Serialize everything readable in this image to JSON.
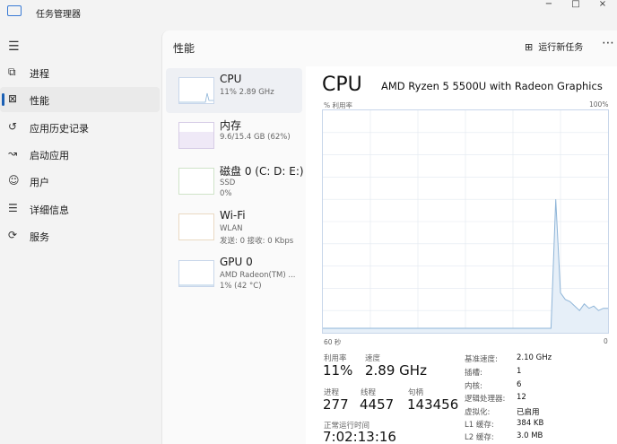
{
  "window": {
    "title": "任务管理器",
    "controls": {
      "minimize": "−",
      "maximize": "□",
      "close": "×"
    }
  },
  "sidebar": {
    "menu_icon": "hamburger-icon",
    "items": [
      {
        "label": "进程",
        "icon": "processes-icon",
        "glyph": "⧉",
        "active": false
      },
      {
        "label": "性能",
        "icon": "performance-icon",
        "glyph": "⊠",
        "active": true
      },
      {
        "label": "应用历史记录",
        "icon": "history-icon",
        "glyph": "↺",
        "active": false
      },
      {
        "label": "启动应用",
        "icon": "startup-icon",
        "glyph": "↝",
        "active": false
      },
      {
        "label": "用户",
        "icon": "users-icon",
        "glyph": "☺",
        "active": false
      },
      {
        "label": "详细信息",
        "icon": "details-icon",
        "glyph": "☰",
        "active": false
      },
      {
        "label": "服务",
        "icon": "services-icon",
        "glyph": "⟳",
        "active": false
      }
    ]
  },
  "header": {
    "title": "性能",
    "run_task_label": "运行新任务",
    "more_label": "⋯"
  },
  "devices": [
    {
      "name": "CPU",
      "sub1": "11% 2.89 GHz",
      "sub2": ""
    },
    {
      "name": "内存",
      "sub1": "9.6/15.4 GB (62%)",
      "sub2": ""
    },
    {
      "name": "磁盘 0 (C: D: E:)",
      "sub1": "SSD",
      "sub2": "0%"
    },
    {
      "name": "Wi-Fi",
      "sub1": "WLAN",
      "sub2": "发送: 0 接收: 0 Kbps"
    },
    {
      "name": "GPU 0",
      "sub1": "AMD Radeon(TM) ...",
      "sub2": "1% (42 °C)"
    }
  ],
  "detail": {
    "title": "CPU",
    "model": "AMD Ryzen 5 5500U with Radeon Graphics",
    "y_label": "% 利用率",
    "y_max_label": "100%",
    "x_left_label": "60 秒",
    "x_right_label": "0"
  },
  "chart_data": {
    "type": "area",
    "title": "",
    "xlabel": "",
    "ylabel": "% 利用率",
    "xlim": [
      60,
      0
    ],
    "ylim": [
      0,
      100
    ],
    "grid": true,
    "series": [
      {
        "values": [
          2,
          2,
          2,
          2,
          2,
          2,
          2,
          2,
          2,
          2,
          2,
          2,
          2,
          2,
          2,
          2,
          2,
          2,
          2,
          2,
          2,
          2,
          2,
          2,
          2,
          2,
          2,
          2,
          2,
          2,
          2,
          2,
          2,
          2,
          2,
          2,
          2,
          2,
          2,
          2,
          2,
          2,
          2,
          2,
          2,
          2,
          2,
          2,
          2,
          60,
          18,
          15,
          14,
          12,
          10,
          13,
          11,
          12,
          10,
          11,
          11
        ]
      }
    ]
  },
  "stats": {
    "utilization_label": "利用率",
    "utilization": "11%",
    "speed_label": "速度",
    "speed": "2.89 GHz",
    "processes_label": "进程",
    "processes": "277",
    "threads_label": "线程",
    "threads": "4457",
    "handles_label": "句柄",
    "handles": "143456",
    "uptime_label": "正常运行时间",
    "uptime": "7:02:13:16"
  },
  "specs": [
    {
      "label": "基准速度:",
      "value": "2.10 GHz"
    },
    {
      "label": "插槽:",
      "value": "1"
    },
    {
      "label": "内核:",
      "value": "6"
    },
    {
      "label": "逻辑处理器:",
      "value": "12"
    },
    {
      "label": "虚拟化:",
      "value": "已启用"
    },
    {
      "label": "L1 缓存:",
      "value": "384 KB"
    },
    {
      "label": "L2 缓存:",
      "value": "3.0 MB"
    }
  ],
  "colors": {
    "accent": "#1a5fb4",
    "chart_line": "#8fb5d8",
    "chart_fill": "#e6eff8",
    "grid": "#e2e8f0"
  }
}
